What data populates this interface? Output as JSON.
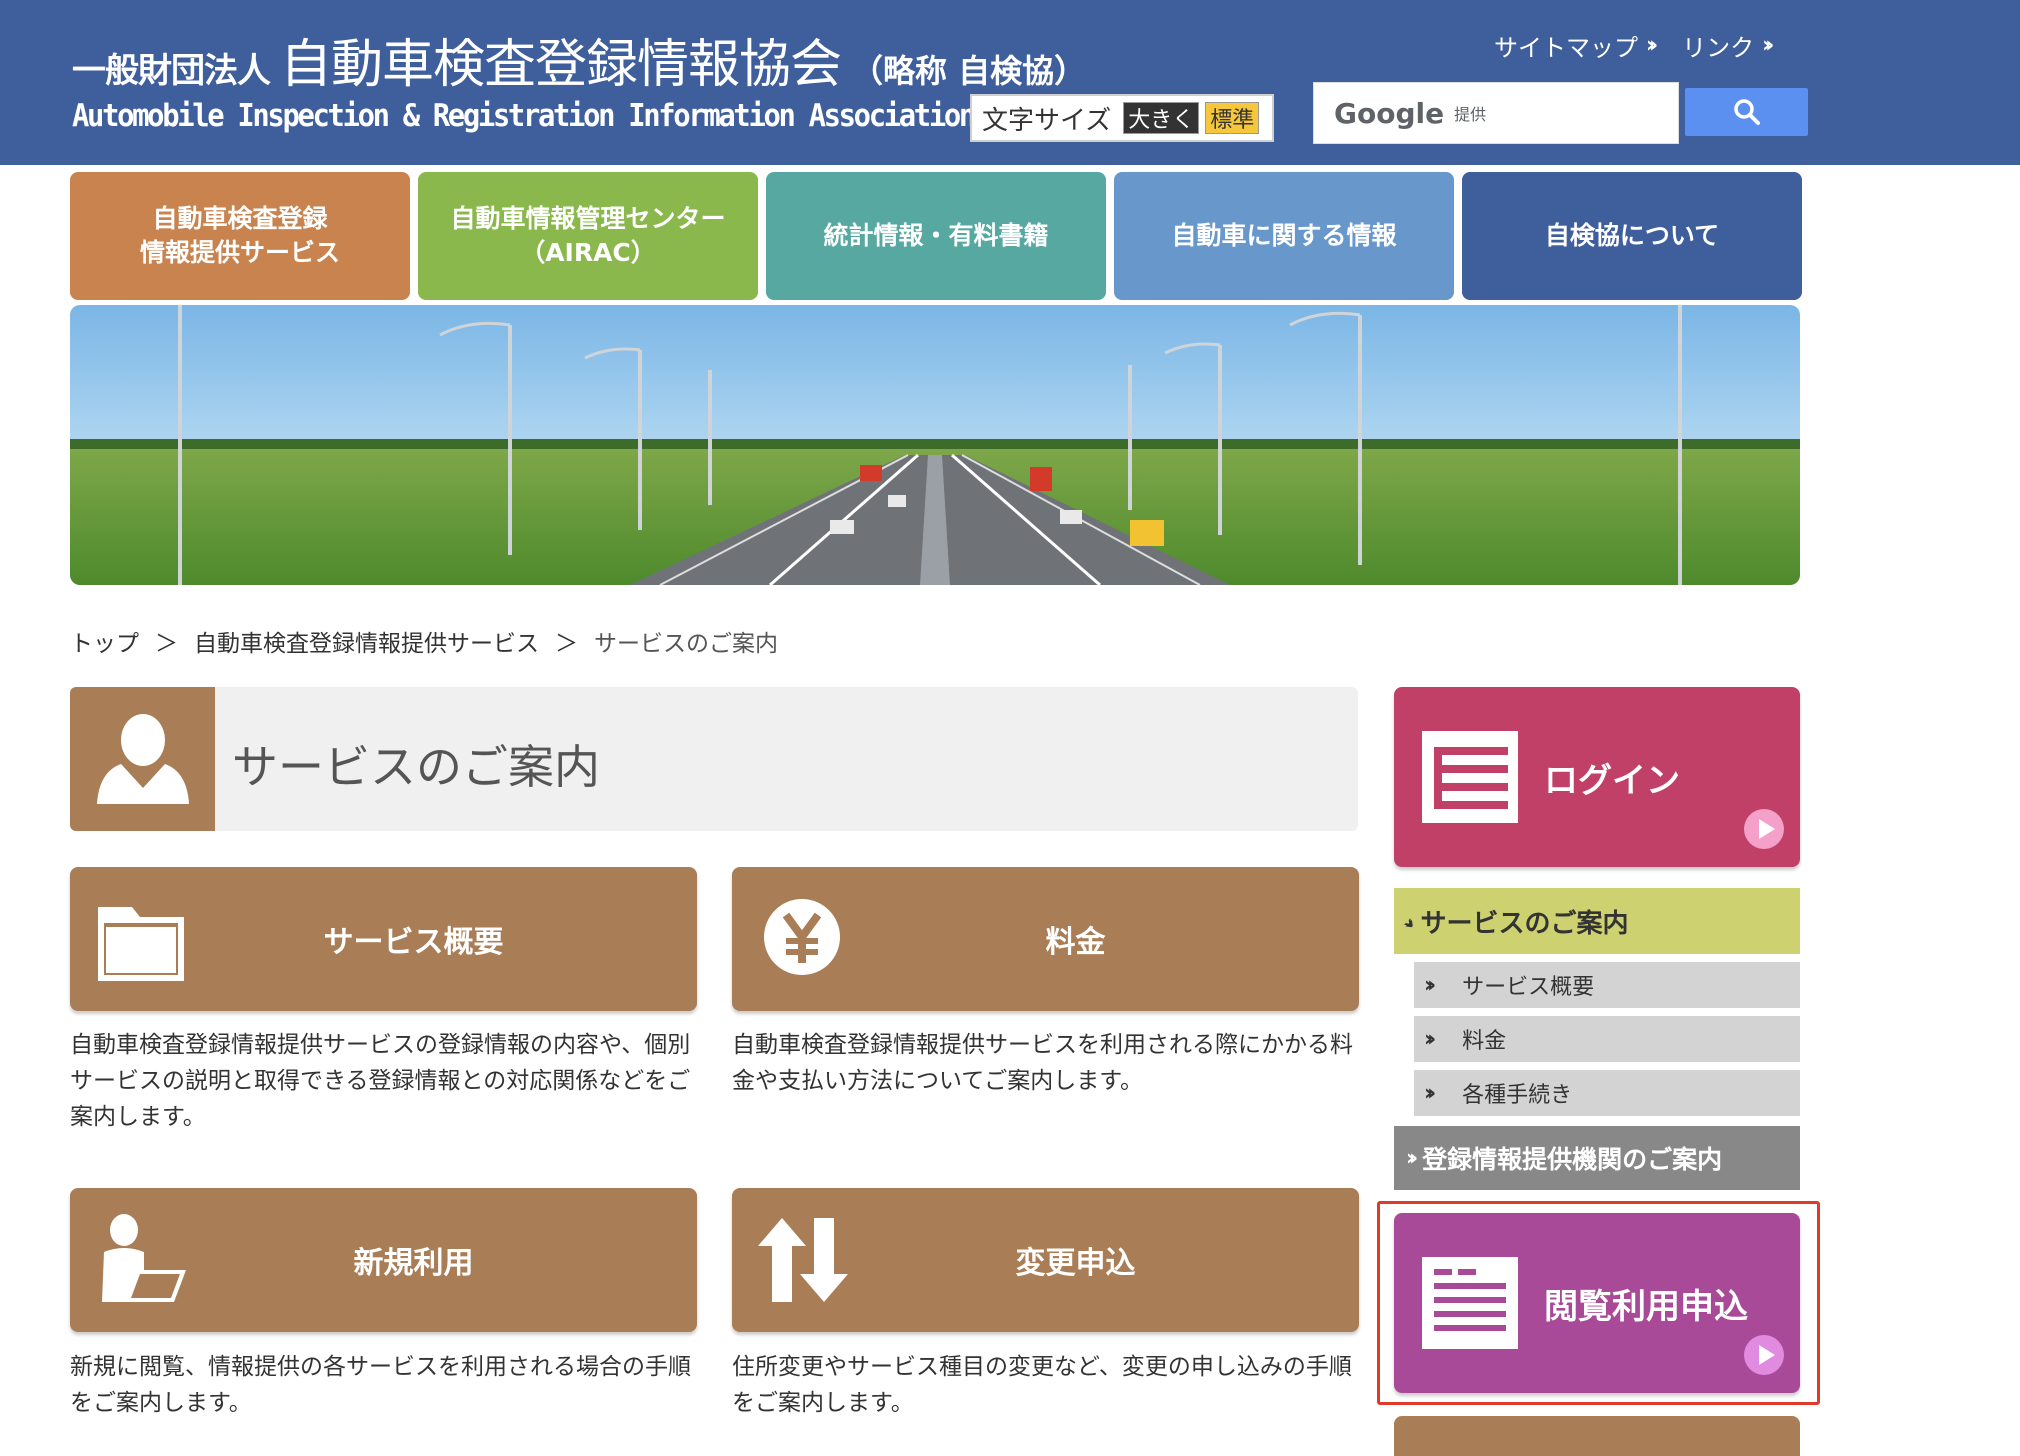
{
  "header": {
    "org_prefix": "一般財団法人",
    "org_name": "自動車検査登録情報協会",
    "org_abbr": "（略称 自検協）",
    "org_english": "Automobile Inspection & Registration Information Association",
    "top_links": [
      {
        "label": "サイトマップ"
      },
      {
        "label": "リンク"
      }
    ],
    "font_size": {
      "label": "文字サイズ",
      "large": "大きく",
      "standard": "標準"
    },
    "search": {
      "google": "Google",
      "provided": "提供"
    }
  },
  "nav": {
    "tabs": [
      {
        "label": "自動車検査登録\n情報提供サービス",
        "color": "#c8834e"
      },
      {
        "label": "自動車情報管理センター\n（AIRAC）",
        "color": "#8ab84c"
      },
      {
        "label": "統計情報・有料書籍",
        "color": "#56a8a0"
      },
      {
        "label": "自動車に関する情報",
        "color": "#6897cc"
      },
      {
        "label": "自検協について",
        "color": "#3f5e9c"
      }
    ]
  },
  "breadcrumb": {
    "items": [
      "トップ",
      "自動車検査登録情報提供サービス"
    ],
    "separator": "＞",
    "current": "サービスのご案内"
  },
  "page": {
    "title": "サービスのご案内"
  },
  "cards": [
    {
      "label": "サービス概要",
      "desc": "自動車検査登録情報提供サービスの登録情報の内容や、個別サービスの説明と取得できる登録情報との対応関係などをご案内します。",
      "icon": "folder-icon"
    },
    {
      "label": "料金",
      "desc": "自動車検査登録情報提供サービスを利用される際にかかる料金や支払い方法についてご案内します。",
      "icon": "yen-icon"
    },
    {
      "label": "新規利用",
      "desc": "新規に閲覧、情報提供の各サービスを利用される場合の手順をご案内します。",
      "icon": "person-laptop-icon"
    },
    {
      "label": "変更申込",
      "desc": "住所変更やサービス種目の変更など、変更の申し込みの手順をご案内します。",
      "icon": "arrows-updown-icon"
    }
  ],
  "sidebar": {
    "login_label": "ログイン",
    "section_label": "サービスのご案内",
    "sub_items": [
      "サービス概要",
      "料金",
      "各種手続き"
    ],
    "section2_label": "登録情報提供機関のご案内",
    "apply_label": "閲覧利用申込"
  },
  "colors": {
    "header": "#3f5e9c",
    "card": "#a97e57",
    "login": "#c04068",
    "apply": "#a84a98",
    "highlight": "#e03b2a"
  }
}
